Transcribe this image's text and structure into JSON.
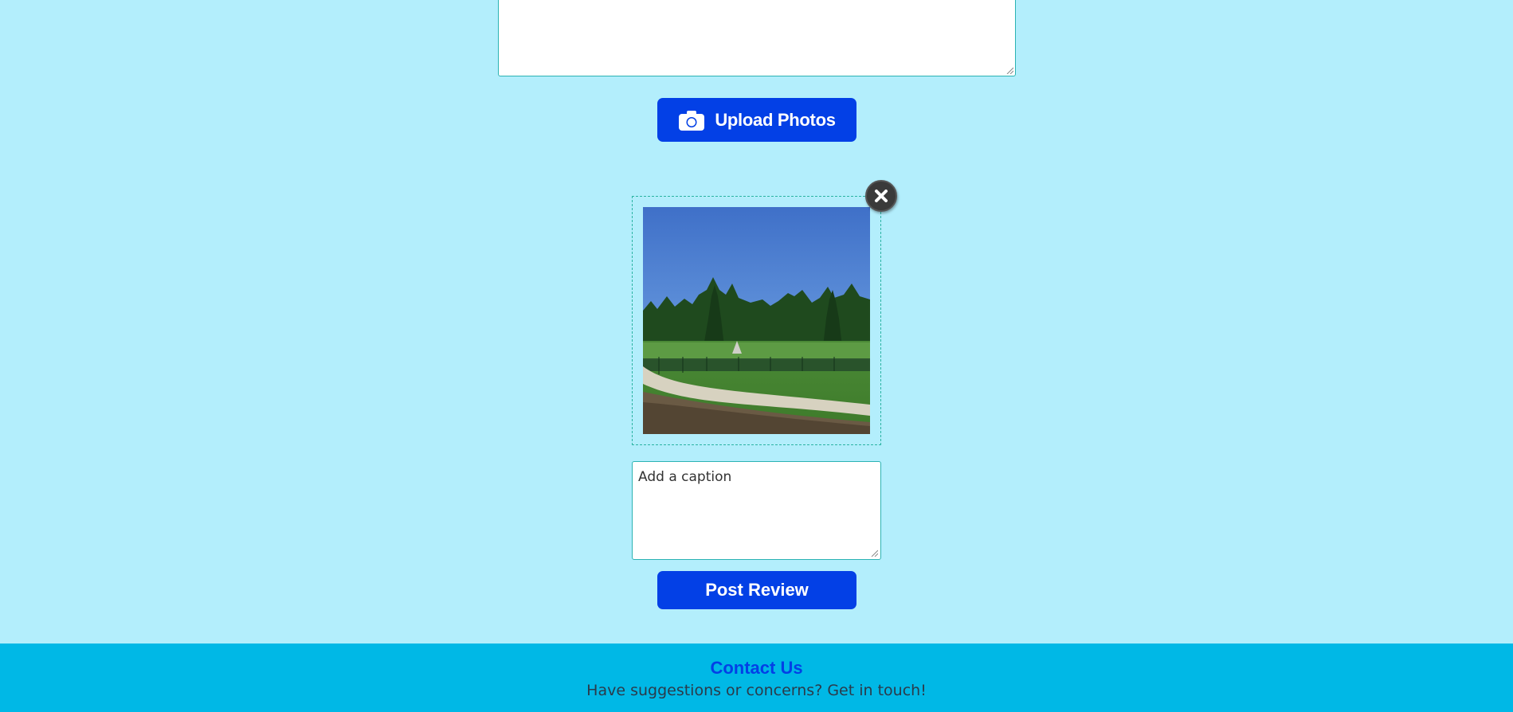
{
  "review_form": {
    "review_text": "",
    "upload_button_label": "Upload Photos",
    "upload_icon": "camera-icon",
    "remove_photo_icon": "close-icon",
    "photo_description": "park field with trees, fence and path under blue sky",
    "caption_placeholder": "Add a caption",
    "post_button_label": "Post Review"
  },
  "footer": {
    "title": "Contact Us",
    "text": "Have suggestions or concerns? Get in touch!"
  },
  "colors": {
    "page_background": "#b3eefc",
    "primary_button": "#0340e6",
    "footer_background": "#00b8e6",
    "footer_title": "#0340e6"
  }
}
